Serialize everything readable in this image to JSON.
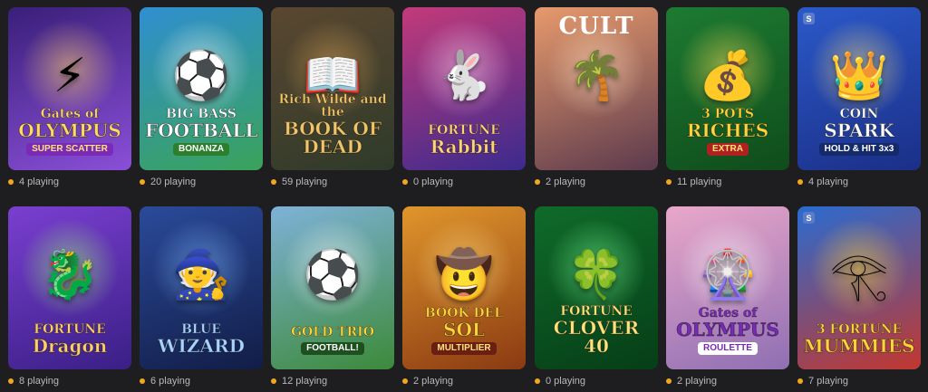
{
  "games": [
    {
      "title_line1": "Gates of",
      "title_line2": "OLYMPUS",
      "title_line3": "SUPER SCATTER",
      "players": "4 playing",
      "icon": "zeus-icon",
      "hero": "⚡",
      "colors": [
        "#3a1f7a",
        "#8a4fd8"
      ],
      "glow": "#ffd46a",
      "title_color": "#ffd867",
      "sub_bg": "#7b2ab8",
      "sub_color": "#ffe27a"
    },
    {
      "title_line1": "BIG BASS",
      "title_line2": "FOOTBALL",
      "title_line3": "BONANZA",
      "players": "20 playing",
      "icon": "soccer-ball-icon",
      "hero": "⚽",
      "colors": [
        "#2f8fd0",
        "#3aa35a"
      ],
      "glow": "#ffffff",
      "title_color": "#ffffff",
      "sub_bg": "#2c7f2d",
      "sub_color": "#ffffff"
    },
    {
      "title_line1": "Rich Wilde and the",
      "title_line2": "BOOK OF DEAD",
      "title_line3": "",
      "players": "59 playing",
      "icon": "book-icon",
      "hero": "📖",
      "colors": [
        "#5a4730",
        "#2f3a2a"
      ],
      "glow": "#d9a456",
      "title_color": "#f1c46a",
      "sub_bg": "transparent",
      "sub_color": "#ffffff"
    },
    {
      "title_line1": "FORTUNE",
      "title_line2": "Rabbit",
      "title_line3": "",
      "players": "0 playing",
      "icon": "rabbit-icon",
      "hero": "🐇",
      "colors": [
        "#c33a7a",
        "#3b2a8e"
      ],
      "glow": "#ffd0ef",
      "title_color": "#ffd37a",
      "sub_bg": "transparent",
      "sub_color": "#ffffff"
    },
    {
      "title_line1": "",
      "title_line2": "",
      "title_line3": "",
      "top_title": "CULT",
      "players": "2 playing",
      "icon": "palm-tree-icon",
      "hero": "🌴",
      "colors": [
        "#e79a6c",
        "#5c3a4d"
      ],
      "glow": "#ffe1c0",
      "title_color": "#ffffff",
      "sub_bg": "transparent",
      "sub_color": "#ffffff"
    },
    {
      "title_line1": "3 POTS",
      "title_line2": "RICHES",
      "title_line3": "EXTRA",
      "players": "11 playing",
      "icon": "pot-of-gold-icon",
      "hero": "💰",
      "colors": [
        "#1d7b31",
        "#0f4c1c"
      ],
      "glow": "#ffe05a",
      "title_color": "#ffd43b",
      "sub_bg": "#b02020",
      "sub_color": "#ffe27a"
    },
    {
      "title_line1": "COIN",
      "title_line2": "SPARK",
      "title_line3": "HOLD & HIT 3x3",
      "players": "4 playing",
      "icon": "crown-icon",
      "hero": "👑",
      "colors": [
        "#2b59c9",
        "#1b2f87"
      ],
      "glow": "#ffe27a",
      "title_color": "#ffffff",
      "sub_bg": "#152a6b",
      "sub_color": "#ffffff",
      "badge": "S"
    },
    {
      "title_line1": "FORTUNE",
      "title_line2": "Dragon",
      "title_line3": "",
      "players": "8 playing",
      "icon": "dragon-icon",
      "hero": "🐉",
      "colors": [
        "#7a3fd0",
        "#3a1f86"
      ],
      "glow": "#9dff7a",
      "title_color": "#ffd06a",
      "sub_bg": "transparent",
      "sub_color": "#ffffff"
    },
    {
      "title_line1": "BLUE",
      "title_line2": "WIZARD",
      "title_line3": "",
      "players": "6 playing",
      "icon": "wizard-icon",
      "hero": "🧙",
      "colors": [
        "#2a4a9a",
        "#121d47"
      ],
      "glow": "#7fb8ff",
      "title_color": "#a9d3ff",
      "sub_bg": "transparent",
      "sub_color": "#ffffff"
    },
    {
      "title_line1": "GOLD TRIO",
      "title_line2": "",
      "title_line3": "FOOTBALL!",
      "players": "12 playing",
      "icon": "soccer-ball-icon",
      "hero": "⚽",
      "colors": [
        "#7fb2d8",
        "#3c8a3a"
      ],
      "glow": "#ffffff",
      "title_color": "#ffd43b",
      "sub_bg": "#1d4f1f",
      "sub_color": "#ffffff"
    },
    {
      "title_line1": "BOOK DEL",
      "title_line2": "SOL",
      "title_line3": "MULTIPLIER",
      "players": "2 playing",
      "icon": "explorer-icon",
      "hero": "🤠",
      "colors": [
        "#e0962c",
        "#8a3a12"
      ],
      "glow": "#ffe08a",
      "title_color": "#ffd43b",
      "sub_bg": "#6b1f12",
      "sub_color": "#ffe27a"
    },
    {
      "title_line1": "FORTUNE",
      "title_line2": "CLOVER 40",
      "title_line3": "",
      "players": "0 playing",
      "icon": "clover-icon",
      "hero": "🍀",
      "colors": [
        "#0f6b2a",
        "#063e17"
      ],
      "glow": "#7dff9a",
      "title_color": "#ffe27a",
      "sub_bg": "transparent",
      "sub_color": "#ffffff"
    },
    {
      "title_line1": "Gates of",
      "title_line2": "OLYMPUS",
      "title_line3": "ROULETTE",
      "players": "2 playing",
      "icon": "roulette-icon",
      "hero": "🎡",
      "colors": [
        "#e9a7c9",
        "#8f6fb3"
      ],
      "glow": "#ffffff",
      "title_color": "#7a2ab8",
      "sub_bg": "#ffffff",
      "sub_color": "#7a2ab8"
    },
    {
      "title_line1": "3 FORTUNE",
      "title_line2": "MUMMIES",
      "title_line3": "",
      "players": "7 playing",
      "icon": "pharaoh-icon",
      "hero": "𓂀",
      "colors": [
        "#2a6bd0",
        "#c2372f"
      ],
      "glow": "#ffd43b",
      "title_color": "#ffd43b",
      "sub_bg": "transparent",
      "sub_color": "#ffffff",
      "badge": "S"
    }
  ]
}
